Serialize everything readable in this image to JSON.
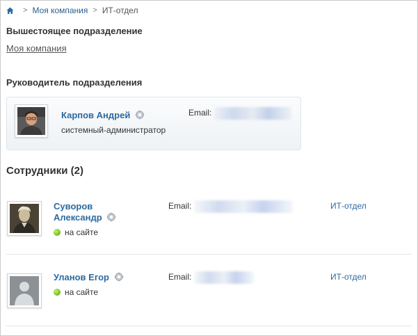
{
  "breadcrumb": {
    "home_icon": "home-icon",
    "items": [
      "Моя компания",
      "ИТ-отдел"
    ]
  },
  "parent_section": {
    "title": "Вышестоящее подразделение",
    "link": "Моя компания"
  },
  "head_section": {
    "title": "Руководитель подразделения",
    "person": {
      "name": "Карпов Андрей",
      "position": "системный-администратор",
      "email_label": "Email:"
    }
  },
  "employees": {
    "title": "Сотрудники (2)",
    "items": [
      {
        "name_line1": "Суворов",
        "name_line2": "Александр",
        "status": "на сайте",
        "email_label": "Email:",
        "department": "ИТ-отдел"
      },
      {
        "name_line1": "Уланов Егор",
        "status": "на сайте",
        "email_label": "Email:",
        "department": "ИТ-отдел"
      }
    ]
  },
  "colors": {
    "link": "#2d6aa0",
    "online": "#72b81c",
    "card_bg": "#eef2f5"
  }
}
